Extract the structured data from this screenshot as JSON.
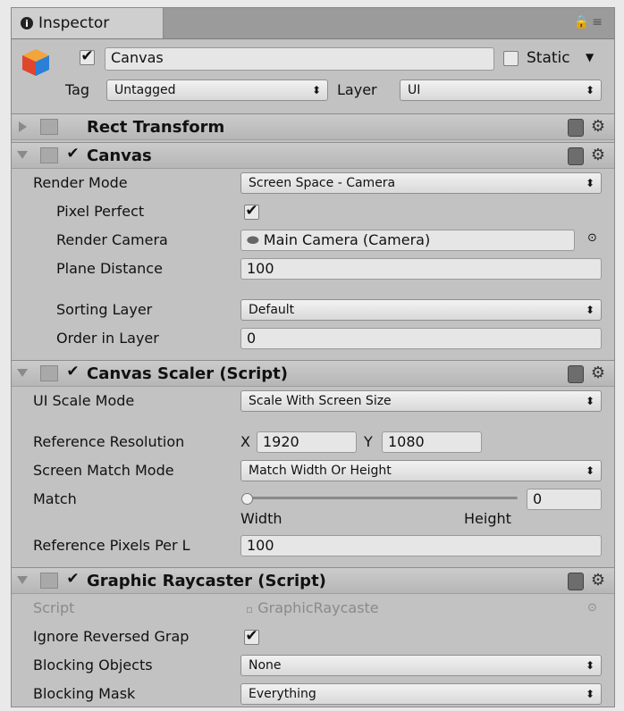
{
  "window": {
    "tab_title": "Inspector"
  },
  "object": {
    "name": "Canvas",
    "active": true,
    "static_label": "Static",
    "tag_label": "Tag",
    "tag_value": "Untagged",
    "layer_label": "Layer",
    "layer_value": "UI"
  },
  "rect_transform": {
    "title": "Rect Transform"
  },
  "canvas": {
    "title": "Canvas",
    "render_mode_label": "Render Mode",
    "render_mode_value": "Screen Space - Camera",
    "pixel_perfect_label": "Pixel Perfect",
    "pixel_perfect": true,
    "render_camera_label": "Render Camera",
    "render_camera_value": "Main Camera (Camera)",
    "plane_distance_label": "Plane Distance",
    "plane_distance_value": "100",
    "sorting_layer_label": "Sorting Layer",
    "sorting_layer_value": "Default",
    "order_in_layer_label": "Order in Layer",
    "order_in_layer_value": "0"
  },
  "canvas_scaler": {
    "title": "Canvas Scaler (Script)",
    "ui_scale_mode_label": "UI Scale Mode",
    "ui_scale_mode_value": "Scale With Screen Size",
    "reference_resolution_label": "Reference Resolution",
    "x_label": "X",
    "x_value": "1920",
    "y_label": "Y",
    "y_value": "1080",
    "screen_match_mode_label": "Screen Match Mode",
    "screen_match_mode_value": "Match Width Or Height",
    "match_label": "Match",
    "match_value": "0",
    "match_fraction": 0,
    "width_label": "Width",
    "height_label": "Height",
    "reference_pixels_label": "Reference Pixels Per L",
    "reference_pixels_value": "100"
  },
  "graphic_raycaster": {
    "title": "Graphic Raycaster (Script)",
    "script_label": "Script",
    "script_value": "GraphicRaycaste",
    "ignore_reversed_label": "Ignore Reversed Grap",
    "ignore_reversed": true,
    "blocking_objects_label": "Blocking Objects",
    "blocking_objects_value": "None",
    "blocking_mask_label": "Blocking Mask",
    "blocking_mask_value": "Everything"
  }
}
